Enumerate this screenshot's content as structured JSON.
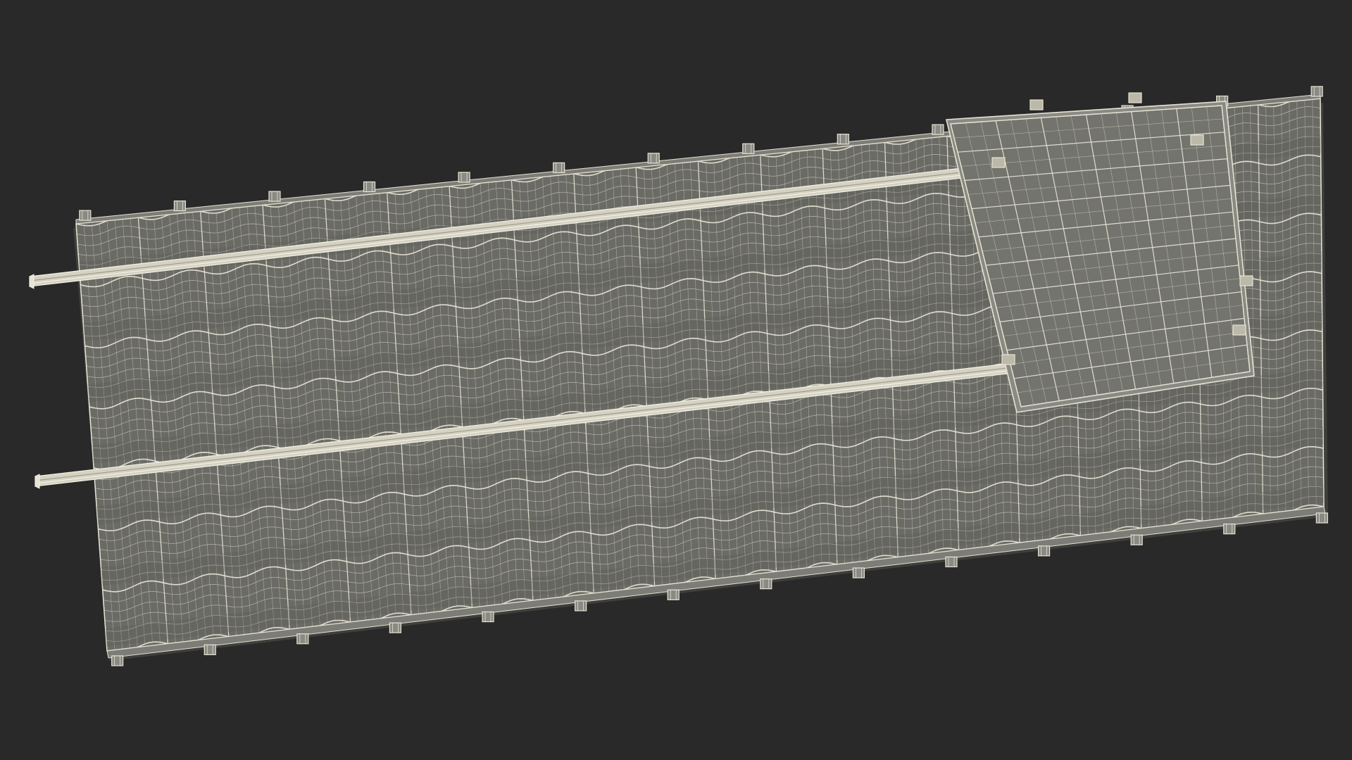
{
  "scene": {
    "background": "#292929",
    "wire_color": "#e7e3d3",
    "surface_color": "#6b6b66",
    "surface_dark": "#585854",
    "rail_color": "#d6d2c2",
    "panel_color": "#74746e"
  }
}
